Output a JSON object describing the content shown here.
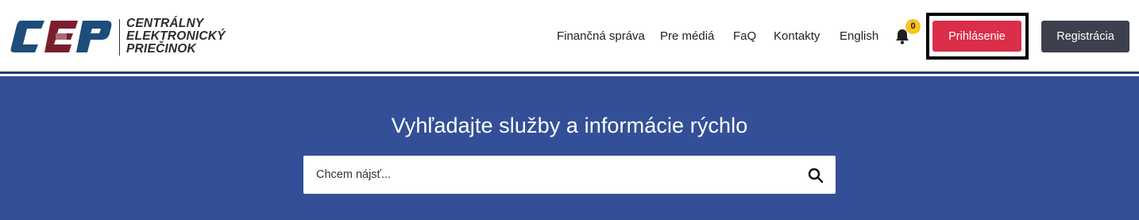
{
  "logo": {
    "abbr": "CEP",
    "lines": [
      "CENTRÁLNY",
      "ELEKTRONICKÝ",
      "PRIEČINOK"
    ],
    "colors": {
      "c": "#1d4d7a",
      "e": "#7a1e2e",
      "p": "#1d4d7a"
    }
  },
  "nav": {
    "items": [
      {
        "label": "Finančná správa"
      },
      {
        "label": "Pre médiá"
      },
      {
        "label": "FaQ"
      },
      {
        "label": "Kontakty"
      },
      {
        "label": "English"
      }
    ]
  },
  "notifications": {
    "icon": "bell-icon",
    "count": "0"
  },
  "buttons": {
    "login_label": "Prihlásenie",
    "register_label": "Registrácia"
  },
  "hero": {
    "title": "Vyhľadajte služby a informácie rýchlo",
    "search_placeholder": "Chcem nájsť...",
    "search_value": "",
    "search_icon": "search-icon"
  },
  "colors": {
    "hero_bg": "#334f97",
    "login_bg": "#da2e49",
    "register_bg": "#3c3f4d",
    "badge_bg": "#f7c51e"
  }
}
